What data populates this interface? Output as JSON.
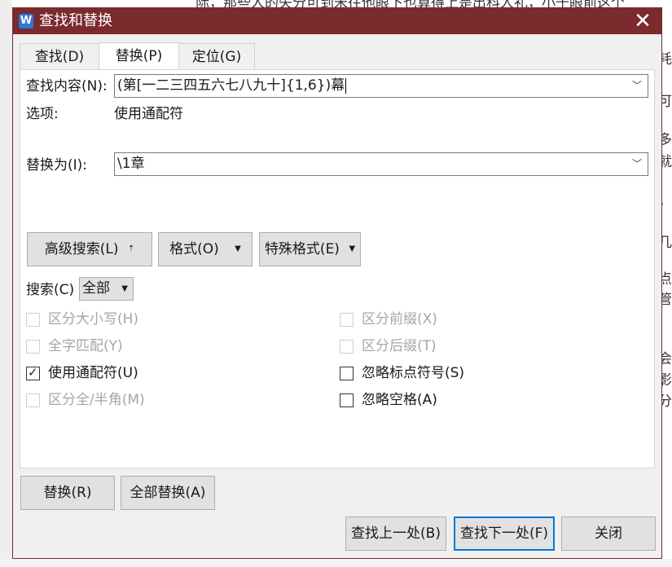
{
  "background_doc": {
    "top_line": "际，那些人的失分可到米往他眼下也算得上是出科人礼，小于眼前这个",
    "right_chars": [
      "耗",
      "可",
      "多",
      "就",
      "，",
      "几",
      "点",
      "管",
      "会",
      "影",
      "分"
    ]
  },
  "window": {
    "title": "查找和替换",
    "app_icon": "W",
    "close_glyph": "✕",
    "accent_color": "#7b2a2e"
  },
  "tabs": [
    {
      "label": "查找(D)",
      "active": false
    },
    {
      "label": "替换(P)",
      "active": true
    },
    {
      "label": "定位(G)",
      "active": false
    }
  ],
  "find": {
    "label": "查找内容(N):",
    "value": "(第[一二三四五六七八九十]{1,6})幕"
  },
  "options": {
    "label": "选项:",
    "value": "使用通配符"
  },
  "replace": {
    "label": "替换为(I):",
    "value": "\\1章"
  },
  "buttons": {
    "advanced": "高级搜索(L)",
    "advanced_icon": "⇡",
    "format": "格式(O)",
    "special": "特殊格式(E)",
    "replace": "替换(R)",
    "replace_all": "全部替换(A)",
    "find_prev": "查找上一处(B)",
    "find_next": "查找下一处(F)",
    "close": "关闭"
  },
  "search": {
    "label": "搜索(C)",
    "value": "全部"
  },
  "checkboxes": [
    {
      "label": "区分大小写(H)",
      "checked": false,
      "disabled": true
    },
    {
      "label": "全字匹配(Y)",
      "checked": false,
      "disabled": true
    },
    {
      "label": "使用通配符(U)",
      "checked": true,
      "disabled": false
    },
    {
      "label": "区分全/半角(M)",
      "checked": false,
      "disabled": true
    },
    {
      "label": "区分前缀(X)",
      "checked": false,
      "disabled": true
    },
    {
      "label": "区分后缀(T)",
      "checked": false,
      "disabled": true
    },
    {
      "label": "忽略标点符号(S)",
      "checked": false,
      "disabled": false
    },
    {
      "label": "忽略空格(A)",
      "checked": false,
      "disabled": false
    }
  ]
}
